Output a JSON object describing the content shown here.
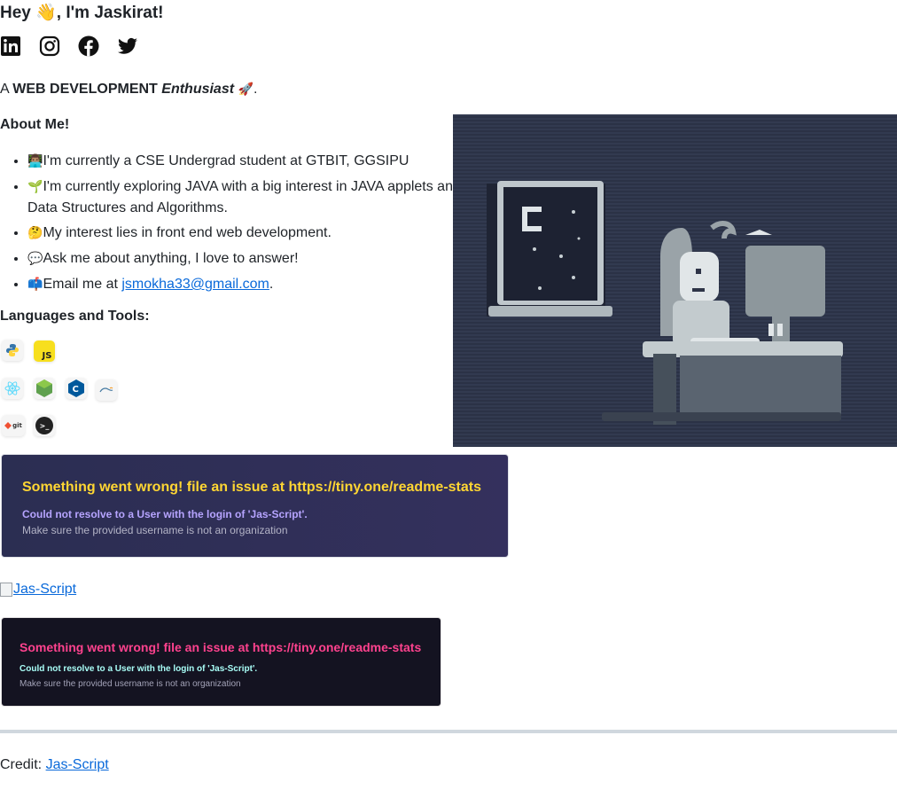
{
  "header": {
    "greeting": "Hey 👋, I'm Jaskirat!"
  },
  "socials": [
    {
      "name": "linkedin-icon"
    },
    {
      "name": "instagram-icon"
    },
    {
      "name": "facebook-icon"
    },
    {
      "name": "twitter-icon"
    }
  ],
  "tagline": {
    "prefix": "A",
    "bold": "WEB DEVELOPMENT",
    "italic": "Enthusiast",
    "emoji": "🚀",
    "suffix": "."
  },
  "about": {
    "heading": "About Me!",
    "items": [
      {
        "emoji": "👨🏽‍💻",
        "text": "I'm currently a CSE Undergrad student at GTBIT, GGSIPU"
      },
      {
        "emoji": "🌱",
        "text": "I'm currently exploring JAVA with a big interest in JAVA applets and Data Structures and Algorithms."
      },
      {
        "emoji": "🤔",
        "text": "My interest lies in front end web development."
      },
      {
        "emoji": "💬",
        "text": "Ask me about anything, I love to answer!"
      },
      {
        "emoji": "📫",
        "text": "Email me at ",
        "link": "jsmokha33@gmail.com",
        "suffix": "."
      }
    ]
  },
  "tools": {
    "heading": "Languages and Tools:",
    "js_label": "JS",
    "git_label": "git",
    "terminal_label": ">_"
  },
  "stats_card": {
    "error": "Something went wrong! file an issue at https://tiny.one/readme-stats",
    "msg1": "Could not resolve to a User with the login of 'Jas-Script'.",
    "msg2": "Make sure the provided username is not an organization"
  },
  "broken_image": {
    "alt": "Jas-Script"
  },
  "langs_card": {
    "error": "Something went wrong! file an issue at https://tiny.one/readme-stats",
    "msg1": "Could not resolve to a User with the login of 'Jas-Script'.",
    "msg2": "Make sure the provided username is not an organization"
  },
  "credit": {
    "label": "Credit:",
    "link": "Jas-Script"
  },
  "colors": {
    "link": "#0969da",
    "card1_error": "#ffd633",
    "card2_error": "#fe428e"
  }
}
